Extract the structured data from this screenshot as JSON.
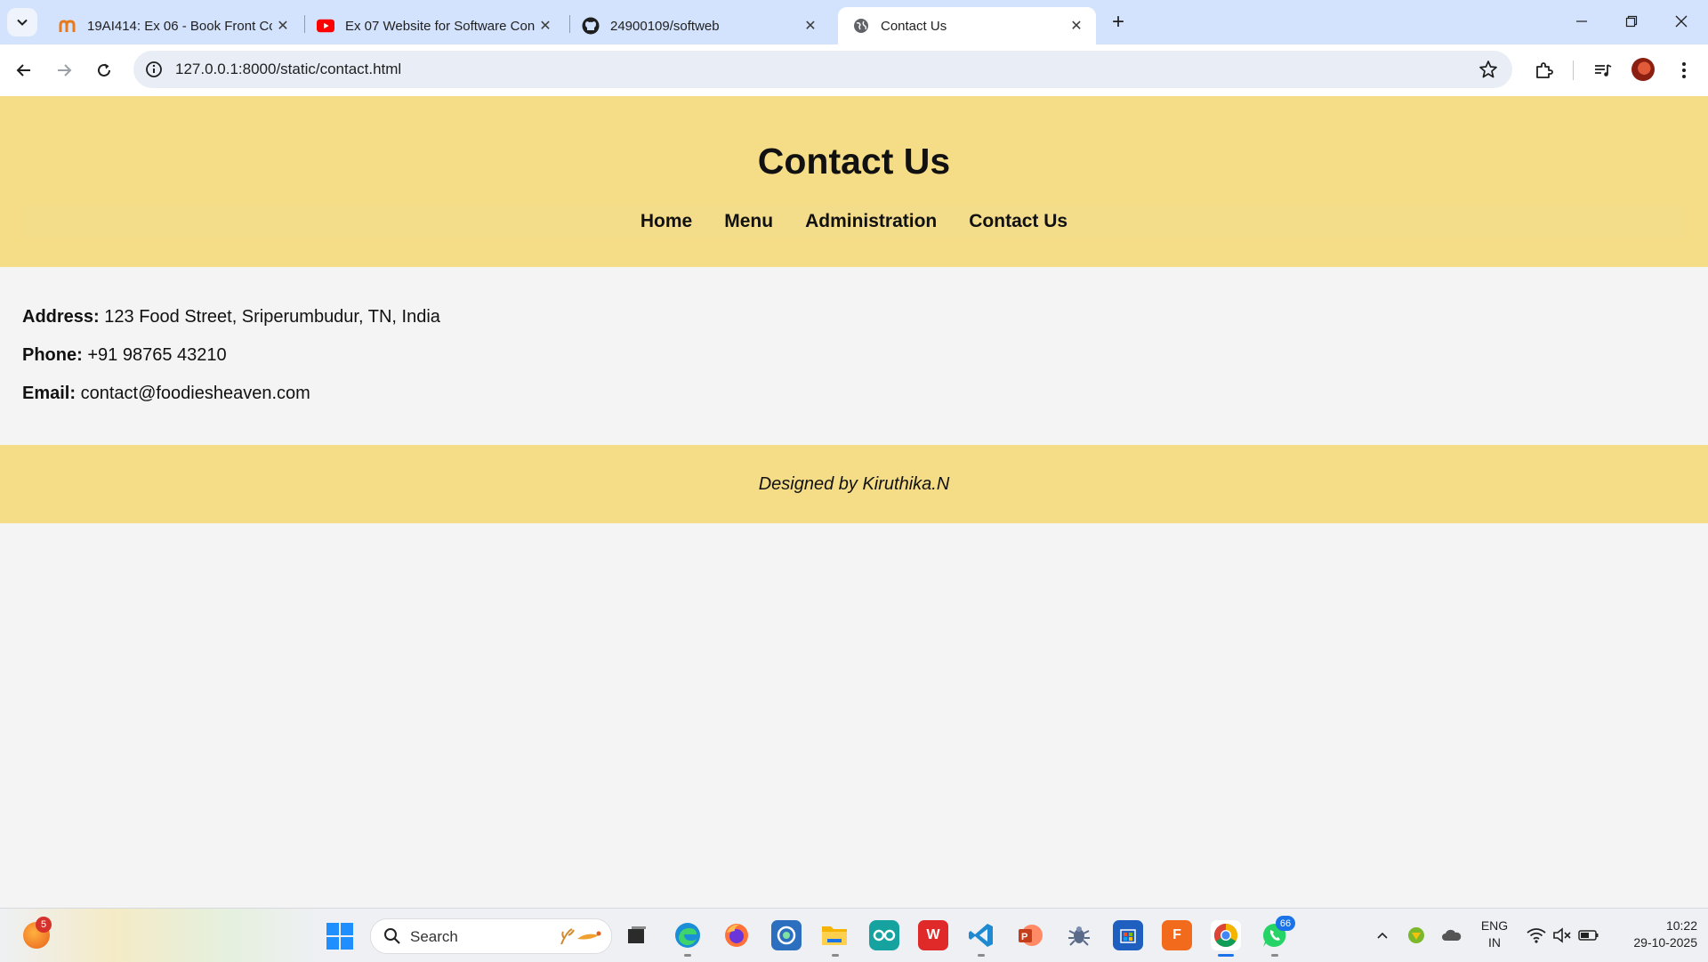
{
  "browser": {
    "tabs": [
      {
        "title": "19AI414: Ex 06 - Book Front Co",
        "favicon": "moodle-icon",
        "active": false
      },
      {
        "title": "Ex 07 Website for Software Con",
        "favicon": "youtube-icon",
        "active": false
      },
      {
        "title": "24900109/softweb",
        "favicon": "github-icon",
        "active": false
      },
      {
        "title": "Contact Us",
        "favicon": "globe-icon",
        "active": true
      }
    ],
    "url": "127.0.0.1:8000/static/contact.html"
  },
  "page": {
    "title": "Contact Us",
    "nav": [
      "Home",
      "Menu",
      "Administration",
      "Contact Us"
    ],
    "contact": {
      "address_label": "Address:",
      "address_value": "123 Food Street, Sriperumbudur, TN, India",
      "phone_label": "Phone:",
      "phone_value": "+91 98765 43210",
      "email_label": "Email:",
      "email_value": "contact@foodiesheaven.com"
    },
    "footer": "Designed by Kiruthika.N",
    "colors": {
      "header_bg": "#f5dc87",
      "page_bg": "#f4f4f4"
    }
  },
  "taskbar": {
    "widget_badge": "5",
    "search_label": "Search",
    "whatsapp_badge": "66",
    "language": [
      "ENG",
      "IN"
    ],
    "time": "10:22",
    "date": "29-10-2025"
  }
}
